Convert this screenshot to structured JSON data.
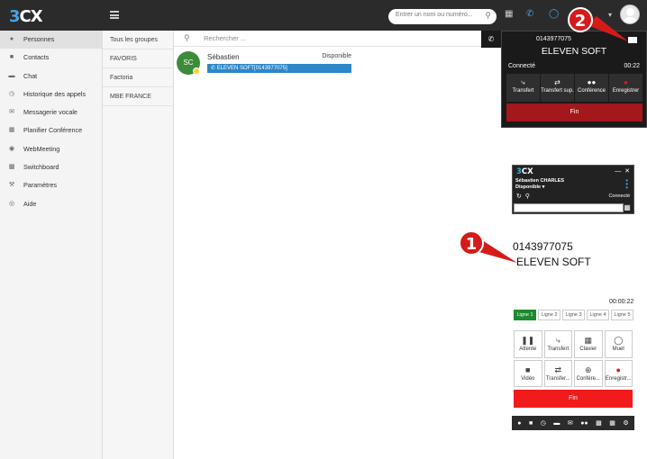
{
  "topbar": {
    "logo_a": "3",
    "logo_b": "CX",
    "search_placeholder": "Entrer un nom ou numéro...",
    "caret": "▾"
  },
  "sidebar": {
    "items": [
      {
        "label": "Personnes",
        "icon": "person-icon"
      },
      {
        "label": "Contacts",
        "icon": "contacts-icon"
      },
      {
        "label": "Chat",
        "icon": "chat-icon"
      },
      {
        "label": "Historique des appels",
        "icon": "call-history-icon"
      },
      {
        "label": "Messagerie vocale",
        "icon": "voicemail-icon"
      },
      {
        "label": "Planifier Conférence",
        "icon": "calendar-icon"
      },
      {
        "label": "WebMeeting",
        "icon": "webmeeting-icon"
      },
      {
        "label": "Switchboard",
        "icon": "switchboard-icon"
      },
      {
        "label": "Paramètres",
        "icon": "wrench-icon"
      },
      {
        "label": "Aide",
        "icon": "help-icon"
      }
    ]
  },
  "groups": {
    "items": [
      "Tous les groupes",
      "FAVORIS",
      "Factoria",
      "MBE FRANCE"
    ]
  },
  "main": {
    "search_placeholder": "Rechercher ...",
    "contact": {
      "initials": "SC",
      "name": "Sébastien",
      "status": "Disponible",
      "active_call": "ELEVEN SOFT[0143977075]"
    }
  },
  "popup": {
    "number": "0143977075",
    "name": "ELEVEN SOFT",
    "state": "Connecté",
    "timer": "00:22",
    "buttons": [
      "Transfert",
      "Transfert sup.",
      "Conférence",
      "Enregistrer"
    ],
    "end_label": "Fin"
  },
  "callouts": {
    "one": "1",
    "two": "2"
  },
  "mini": {
    "brand_a": "3",
    "brand_b": "CX",
    "user": "Sébastien CHARLES",
    "state": "Disponible",
    "connection": "Connecté"
  },
  "dialer": {
    "number": "0143977075",
    "name": "ELEVEN SOFT",
    "timer": "00:00:22",
    "lines": [
      "Ligne 1",
      "Ligne 2",
      "Ligne 3",
      "Ligne 4",
      "Ligne 5"
    ],
    "actions": [
      "Attente",
      "Transfert",
      "Clavier",
      "Muet",
      "Vidéo",
      "Transfer...",
      "Confére...",
      "Enregistr..."
    ],
    "end_label": "Fin"
  },
  "colors": {
    "topbar": "#2b2b2b",
    "accent_blue": "#2d87c8",
    "end_red": "#f21b1b",
    "active_line_green": "#1d8a2f",
    "callout_red": "#d51a1a"
  }
}
